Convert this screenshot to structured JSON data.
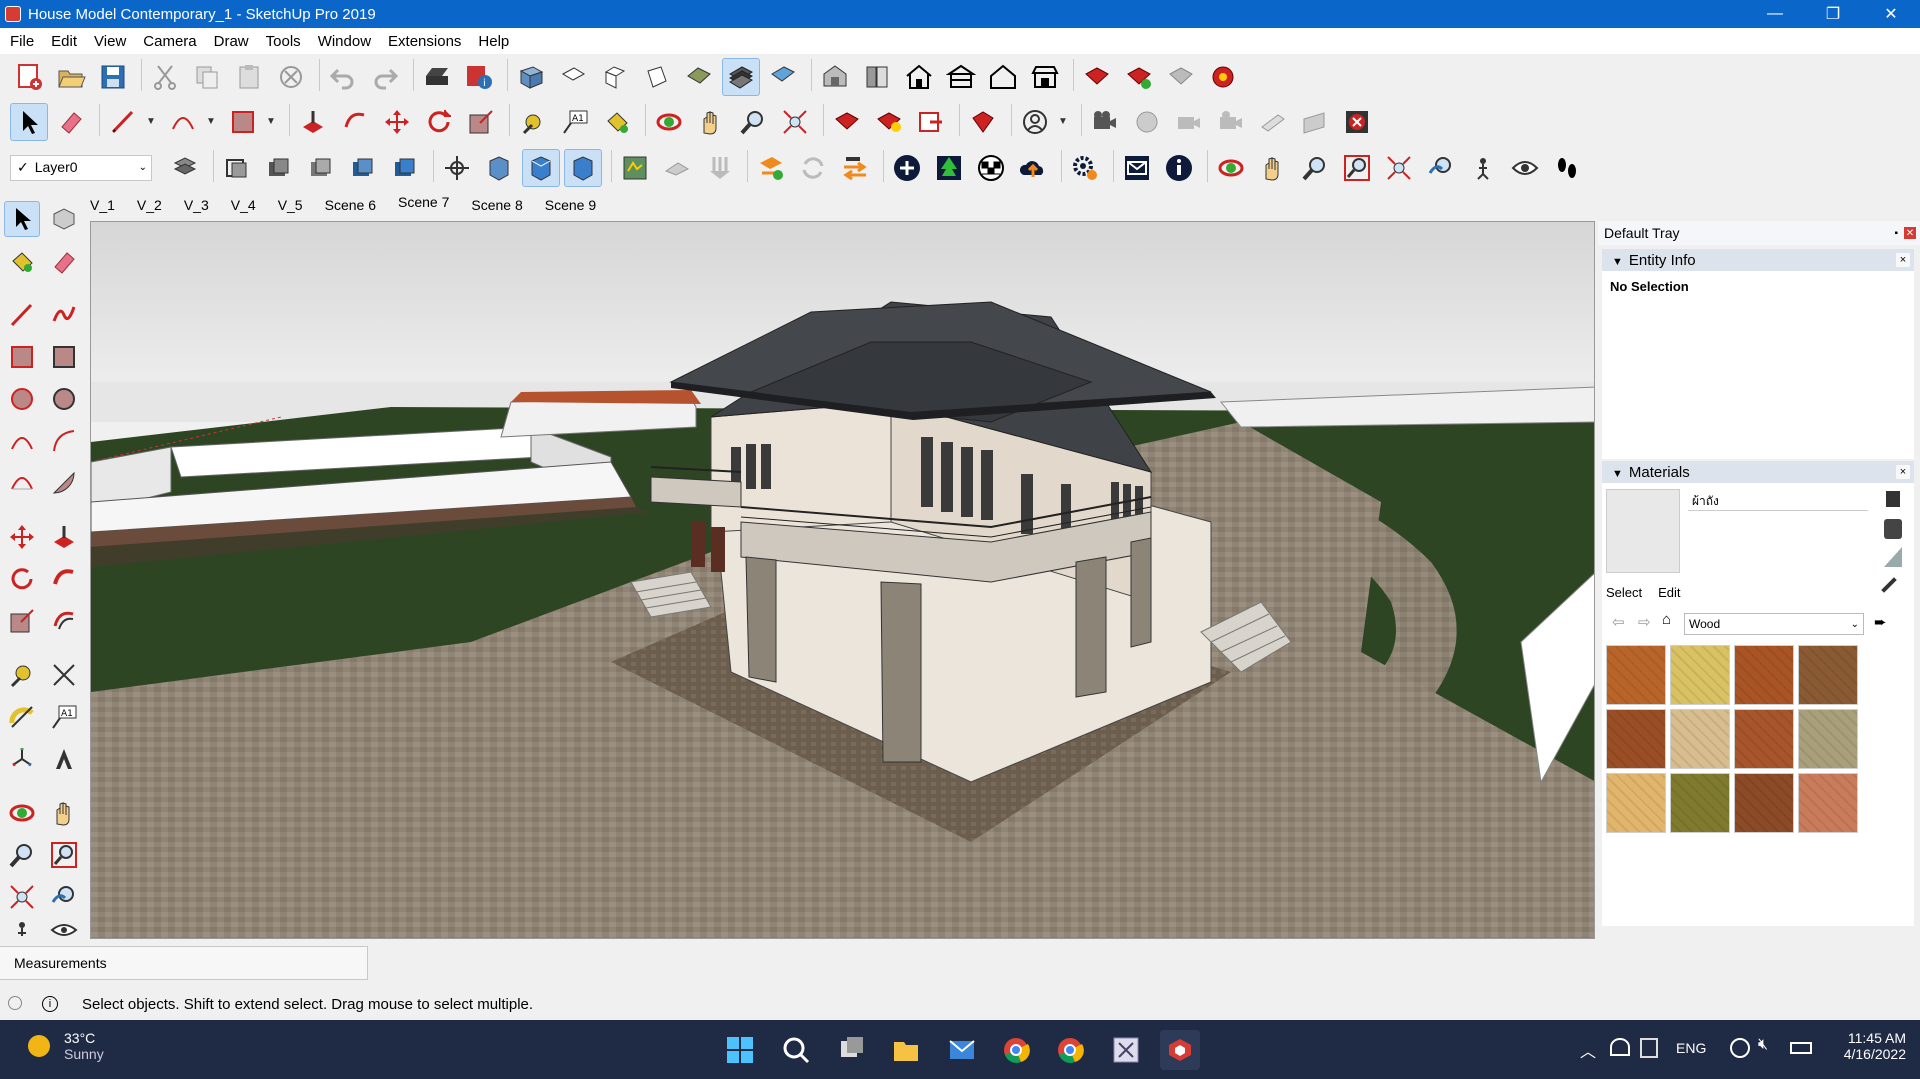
{
  "window": {
    "title": "House Model Contemporary_1 - SketchUp Pro 2019",
    "minimize": "—",
    "restore": "❐",
    "close": "✕"
  },
  "menu": [
    "File",
    "Edit",
    "View",
    "Camera",
    "Draw",
    "Tools",
    "Window",
    "Extensions",
    "Help"
  ],
  "layer": {
    "checked": "✓",
    "name": "Layer0"
  },
  "scenes": [
    "V_1",
    "V_2",
    "V_3",
    "V_4",
    "V_5",
    "Scene 6",
    "Scene 7",
    "Scene 8",
    "Scene 9"
  ],
  "active_scene_index": 6,
  "tray": {
    "title": "Default Tray",
    "pin": "▪",
    "close": "✕",
    "entity_info": {
      "label": "Entity Info",
      "collapse": "▼",
      "close": "×",
      "selection": "No Selection"
    },
    "materials": {
      "label": "Materials",
      "collapse": "▼",
      "close": "×",
      "material_name": "ผ้าถัง",
      "tab_select": "Select",
      "tab_edit": "Edit",
      "collection": "Wood",
      "swatch_colors": [
        "#b9652a",
        "#d9c263",
        "#a95425",
        "#8a5a33",
        "#9a4e25",
        "#d8bd8f",
        "#a7552b",
        "#a9a07a",
        "#e2b56c",
        "#7f7a2e",
        "#8c4a26",
        "#c97c5a"
      ]
    },
    "colors": {
      "header": "#dde3ec",
      "accent": "#0a66c8"
    }
  },
  "measurements": "Measurements",
  "status": "Select objects. Shift to extend select. Drag mouse to select multiple.",
  "taskbar": {
    "weather_temp": "33°C",
    "weather_desc": "Sunny",
    "lang": "ENG",
    "time": "11:45 AM",
    "date": "4/16/2022"
  }
}
